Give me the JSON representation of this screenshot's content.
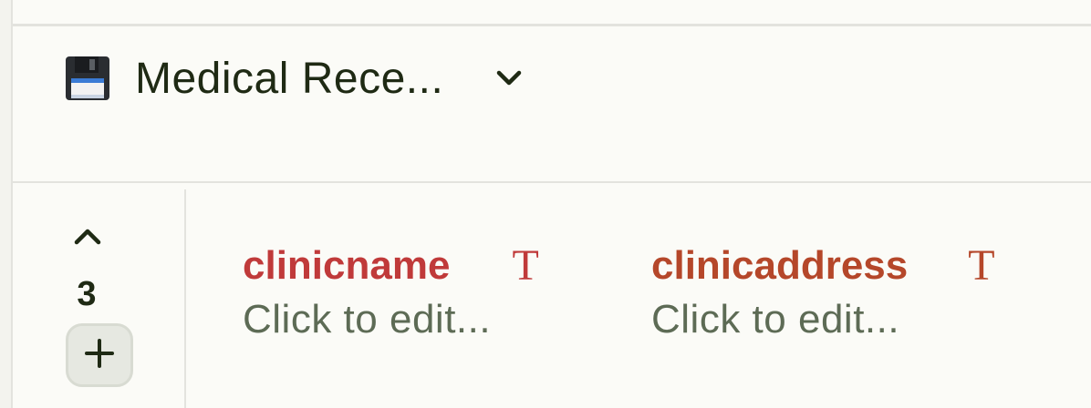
{
  "header": {
    "collection_name": "Medical Rece...",
    "collection_icon": "floppy-disk-icon",
    "dropdown_icon": "chevron-down-icon"
  },
  "record_nav": {
    "collapse_icon": "chevron-up-icon",
    "row_count": "3",
    "add_icon": "plus-icon"
  },
  "fields": [
    {
      "name": "clinicname",
      "type_icon": "T",
      "value_placeholder": "Click to edit...",
      "color": "#c03a3a"
    },
    {
      "name": "clinicaddress",
      "type_icon": "T",
      "value_placeholder": "Click to edit...",
      "color": "#b5472a"
    }
  ],
  "colors": {
    "background": "#fbfbf7",
    "divider": "#e3e3de",
    "text_dark": "#1f2a14",
    "placeholder": "#5d6b55"
  }
}
